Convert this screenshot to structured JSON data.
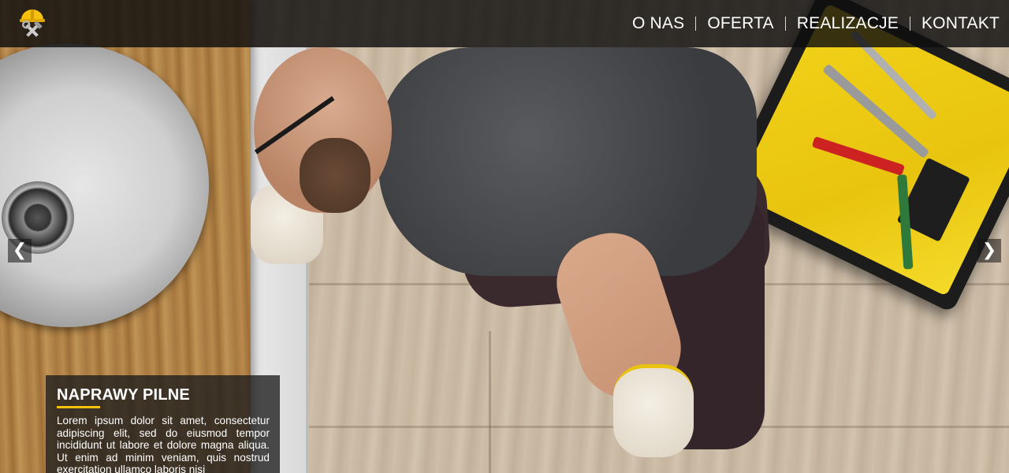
{
  "colors": {
    "accent": "#f4c20d",
    "navbar_bg": "#0e0e0e",
    "text": "#ffffff"
  },
  "logo": {
    "icon": "plumber-helmet-tools-icon"
  },
  "nav": {
    "items": [
      {
        "label": "O NAS"
      },
      {
        "label": "OFERTA"
      },
      {
        "label": "REALIZACJE"
      },
      {
        "label": "KONTAKT"
      }
    ]
  },
  "carousel": {
    "prev": "❮",
    "next": "❯",
    "slide": {
      "image": "plumber-working-under-sink-photo",
      "title": "NAPRAWY PILNE",
      "text": "Lorem ipsum dolor sit amet, consectetur adipiscing elit, sed do eiusmod tempor incididunt ut labore et dolore magna aliqua. Ut enim ad minim veniam, quis nostrud exercitation ullamco laboris nisi"
    }
  }
}
